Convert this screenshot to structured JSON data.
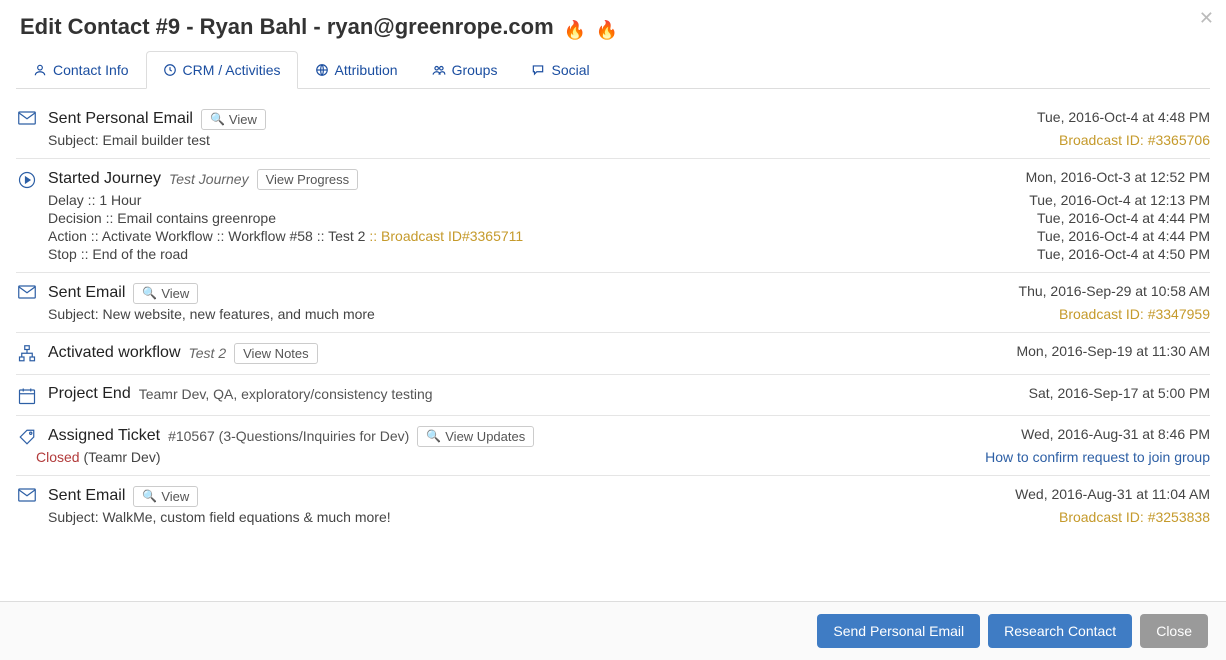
{
  "header": {
    "title": "Edit Contact #9 - Ryan Bahl - ryan@greenrope.com"
  },
  "tabs": {
    "contact_info": "Contact Info",
    "crm_activities": "CRM / Activities",
    "attribution": "Attribution",
    "groups": "Groups",
    "social": "Social"
  },
  "activities": [
    {
      "title": "Sent Personal Email",
      "button": "View",
      "timestamp": "Tue, 2016-Oct-4 at 4:48 PM",
      "subject_label": "Subject:",
      "subject": "Email builder test",
      "broadcast_label": "Broadcast ID:",
      "broadcast_id": "#3365706"
    },
    {
      "title": "Started Journey",
      "subtitle": "Test Journey",
      "button": "View Progress",
      "timestamp": "Mon, 2016-Oct-3 at 12:52 PM",
      "steps": [
        {
          "left": "Delay :: 1 Hour",
          "right": "Tue, 2016-Oct-4 at 12:13 PM"
        },
        {
          "left": "Decision :: Email contains greenrope",
          "right": "Tue, 2016-Oct-4 at 4:44 PM"
        },
        {
          "left": "Action :: Activate Workflow :: Workflow #58 :: Test 2",
          "extra": ":: Broadcast ID#3365711",
          "right": "Tue, 2016-Oct-4 at 4:44 PM"
        },
        {
          "left": "Stop :: End of the road",
          "right": "Tue, 2016-Oct-4 at 4:50 PM"
        }
      ]
    },
    {
      "title": "Sent Email",
      "button": "View",
      "timestamp": "Thu, 2016-Sep-29 at 10:58 AM",
      "subject_label": "Subject:",
      "subject": "New website, new features, and much more",
      "broadcast_label": "Broadcast ID:",
      "broadcast_id": "#3347959"
    },
    {
      "title": "Activated workflow",
      "subtitle": "Test 2",
      "button": "View Notes",
      "timestamp": "Mon, 2016-Sep-19 at 11:30 AM"
    },
    {
      "title": "Project End",
      "plain_sub": "Teamr Dev, QA, exploratory/consistency testing",
      "timestamp": "Sat, 2016-Sep-17 at 5:00 PM"
    },
    {
      "title": "Assigned Ticket",
      "plain_sub": "#10567 (3-Questions/Inquiries for Dev)",
      "button": "View Updates",
      "timestamp": "Wed, 2016-Aug-31 at 8:46 PM",
      "status_left": "Closed",
      "status_suffix": " (Teamr Dev)",
      "status_right": "How to confirm request to join group"
    },
    {
      "title": "Sent Email",
      "button": "View",
      "timestamp": "Wed, 2016-Aug-31 at 11:04 AM",
      "subject_label": "Subject:",
      "subject": "WalkMe, custom field equations & much more!",
      "broadcast_label": "Broadcast ID:",
      "broadcast_id": "#3253838"
    }
  ],
  "footer": {
    "send_personal_email": "Send Personal Email",
    "research_contact": "Research Contact",
    "close": "Close"
  }
}
